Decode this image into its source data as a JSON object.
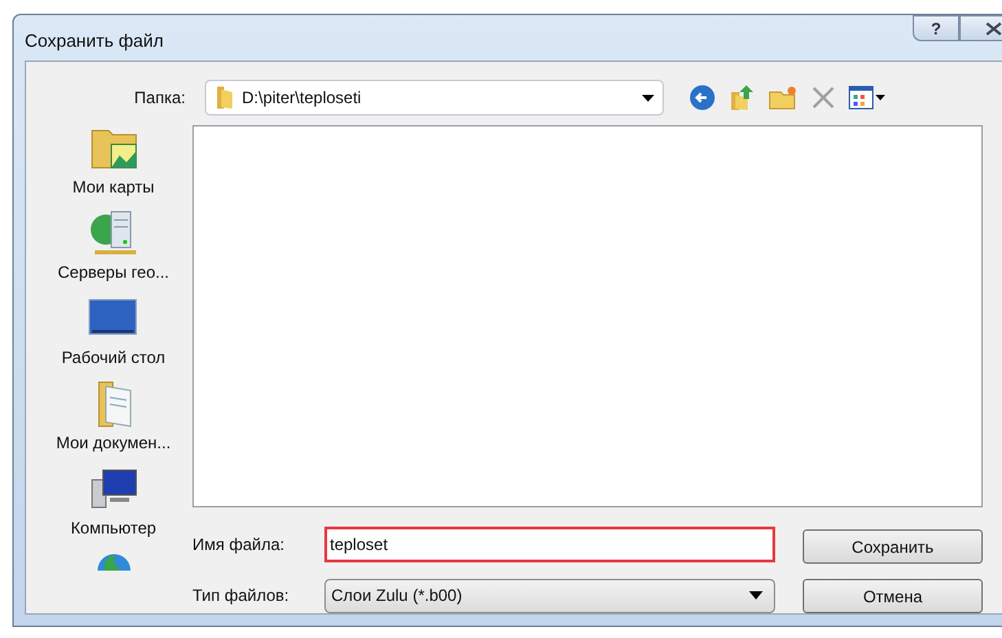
{
  "window": {
    "title": "Сохранить файл",
    "help_button": "?"
  },
  "folder": {
    "label": "Папка:",
    "path": "D:\\piter\\teploseti"
  },
  "places": [
    {
      "label": "Мои карты"
    },
    {
      "label": "Серверы гео..."
    },
    {
      "label": "Рабочий стол"
    },
    {
      "label": "Мои докумен..."
    },
    {
      "label": "Компьютер"
    }
  ],
  "file_name": {
    "label": "Имя файла:",
    "value": "teploset"
  },
  "file_type": {
    "label": "Тип файлов:",
    "value": "Слои Zulu (*.b00)"
  },
  "buttons": {
    "save": "Сохранить",
    "cancel": "Отмена"
  }
}
